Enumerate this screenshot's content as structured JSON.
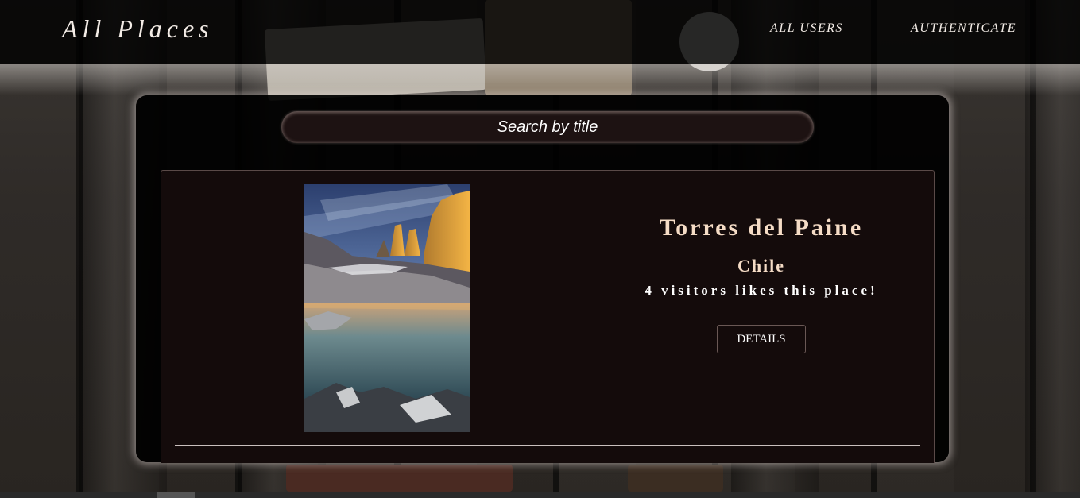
{
  "header": {
    "brand": "All Places",
    "nav": {
      "all_users": "ALL USERS",
      "authenticate": "AUTHENTICATE"
    }
  },
  "search": {
    "placeholder": "Search by title"
  },
  "places": [
    {
      "title": "Torres del Paine",
      "country": "Chile",
      "visitors_text": "4 visitors likes this place!",
      "details_label": "DETAILS",
      "image": "torres-del-paine-photo"
    }
  ],
  "colors": {
    "header_bg": "#000000",
    "panel_bg": "#000000",
    "card_bg": "#140b0b",
    "title_text": "#f5dcc6",
    "light_text": "#ffffff"
  }
}
